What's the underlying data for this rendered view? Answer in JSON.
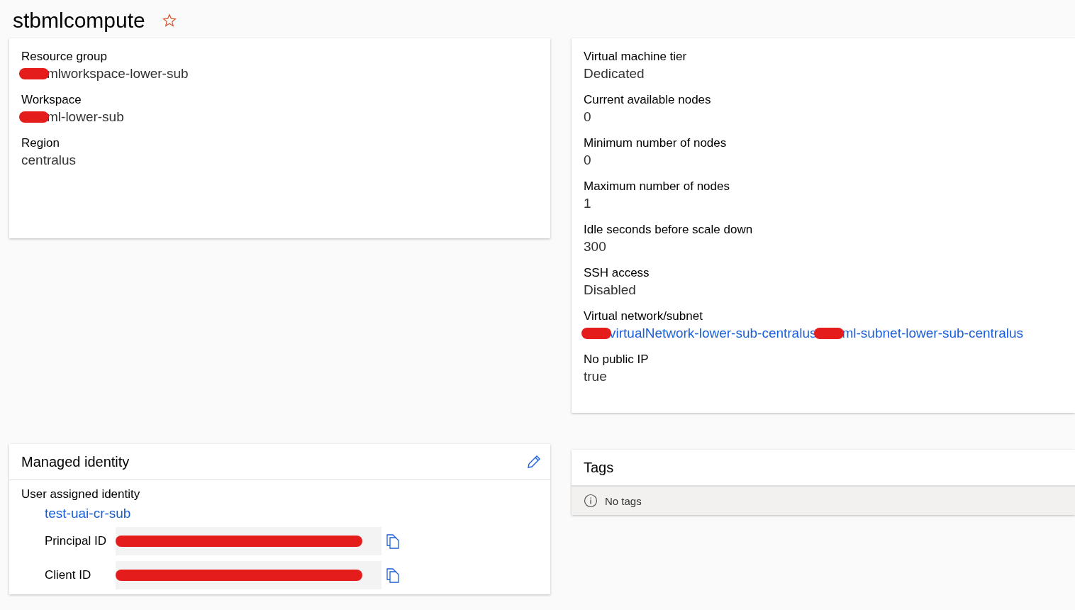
{
  "title": "stbmlcompute",
  "favorite": false,
  "left_properties": [
    {
      "label": "Resource group",
      "value": [
        {
          "kind": "redacted"
        },
        {
          "kind": "text",
          "text": "mlworkspace-lower-sub"
        }
      ]
    },
    {
      "label": "Workspace",
      "value": [
        {
          "kind": "redacted"
        },
        {
          "kind": "text",
          "text": "ml-lower-sub"
        }
      ]
    },
    {
      "label": "Region",
      "value": [
        {
          "kind": "text",
          "text": "centralus"
        }
      ]
    }
  ],
  "right_properties": [
    {
      "label": "Virtual machine tier",
      "value": [
        {
          "kind": "text",
          "text": "Dedicated"
        }
      ]
    },
    {
      "label": "Current available nodes",
      "value": [
        {
          "kind": "text",
          "text": "0"
        }
      ]
    },
    {
      "label": "Minimum number of nodes",
      "value": [
        {
          "kind": "text",
          "text": "0"
        }
      ]
    },
    {
      "label": "Maximum number of nodes",
      "value": [
        {
          "kind": "text",
          "text": "1"
        }
      ]
    },
    {
      "label": "Idle seconds before scale down",
      "value": [
        {
          "kind": "text",
          "text": "300"
        }
      ]
    },
    {
      "label": "SSH access",
      "value": [
        {
          "kind": "text",
          "text": "Disabled"
        }
      ]
    },
    {
      "label": "Virtual network/subnet",
      "value": [
        {
          "kind": "redacted"
        },
        {
          "kind": "link",
          "text": "virtualNetwork-lower-sub-centralus"
        },
        {
          "kind": "redacted"
        },
        {
          "kind": "link",
          "text": "ml-subnet-lower-sub-centralus"
        }
      ]
    },
    {
      "label": "No public IP",
      "value": [
        {
          "kind": "text",
          "text": "true"
        }
      ]
    }
  ],
  "managed_identity": {
    "title": "Managed identity",
    "type_label": "User assigned identity",
    "identity": "test-uai-cr-sub",
    "ids": [
      {
        "label": "Principal ID",
        "redacted": true
      },
      {
        "label": "Client ID",
        "redacted": true
      }
    ]
  },
  "tags": {
    "title": "Tags",
    "message": "No tags"
  }
}
